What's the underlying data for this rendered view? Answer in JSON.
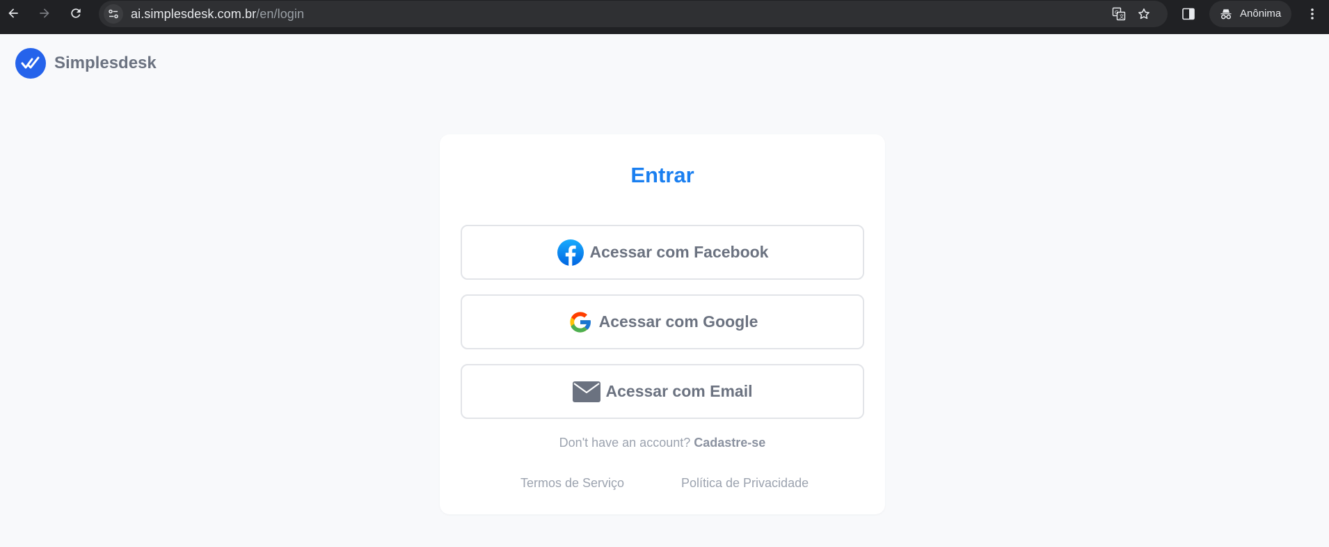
{
  "browser": {
    "url_host": "ai.simplesdesk.com.br",
    "url_path": "/en/login",
    "profile_label": "Anônima"
  },
  "brand": {
    "name": "Simplesdesk",
    "color": "#2563eb"
  },
  "login": {
    "title": "Entrar",
    "title_color": "#1a7ff0",
    "buttons": [
      {
        "label": "Acessar com Facebook",
        "icon": "facebook-icon"
      },
      {
        "label": "Acessar com Google",
        "icon": "google-icon"
      },
      {
        "label": "Acessar com Email",
        "icon": "mail-icon"
      }
    ],
    "signup_prompt": "Don't have an account?",
    "signup_link": "Cadastre-se",
    "footer": {
      "terms": "Termos de Serviço",
      "privacy": "Política de Privacidade"
    }
  }
}
